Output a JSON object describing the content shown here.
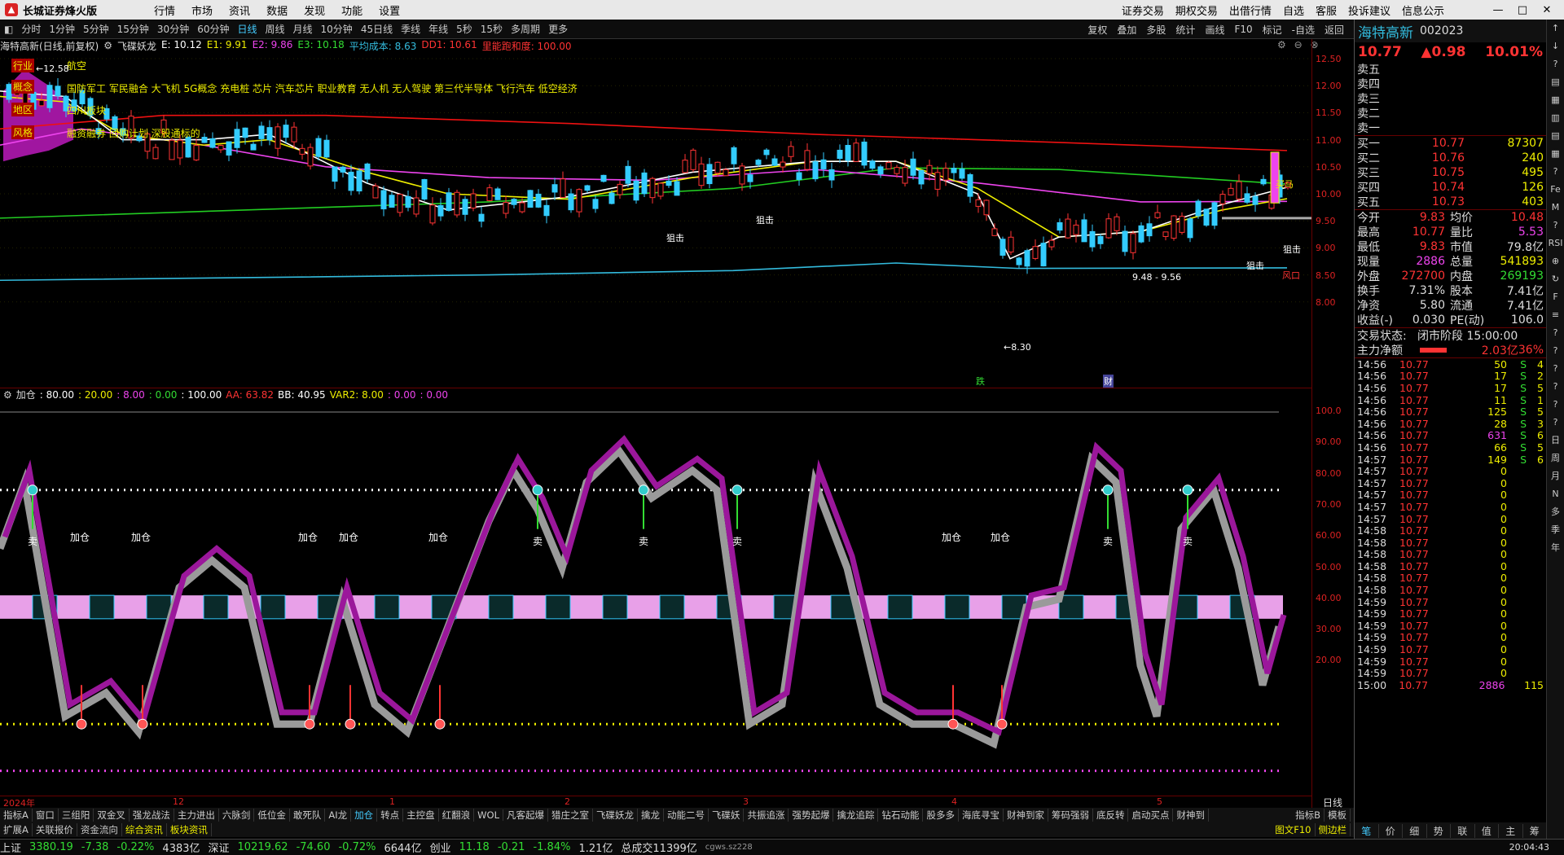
{
  "app": {
    "name": "长城证券烽火版",
    "menu": [
      "行情",
      "市场",
      "资讯",
      "数据",
      "发现",
      "功能",
      "设置"
    ],
    "right_menu": [
      "证券交易",
      "期权交易",
      "出借行情",
      "自选",
      "客服",
      "投诉建议",
      "信息公示"
    ]
  },
  "toolbar": {
    "items": [
      "分时",
      "1分钟",
      "5分钟",
      "15分钟",
      "30分钟",
      "60分钟",
      "日线",
      "周线",
      "月线",
      "10分钟",
      "45日线",
      "季线",
      "年线",
      "5秒",
      "15秒",
      "多周期",
      "更多"
    ],
    "active": "日线",
    "right": [
      "复权",
      "叠加",
      "多股",
      "统计",
      "画线",
      "F10",
      "标记",
      "-自选",
      "返回"
    ]
  },
  "main_chart": {
    "stock_title": "海特高新(日线,前复权)",
    "indicator_name": "飞碟妖龙",
    "legend": [
      {
        "t": "E: 10.12",
        "c": "#fff"
      },
      {
        "t": "E1: 9.91",
        "c": "#ee0"
      },
      {
        "t": "E2: 9.86",
        "c": "#e4e"
      },
      {
        "t": "E3: 10.18",
        "c": "#3d3"
      },
      {
        "t": "平均成本: 8.63",
        "c": "#3bd"
      },
      {
        "t": "DD1: 10.61",
        "c": "#f33"
      },
      {
        "t": "里能跑和度: 100.00",
        "c": "#f33"
      }
    ],
    "concept_labels": {
      "tag1": "行业",
      "tag2": "概念",
      "tag3": "地区",
      "tag4": "风格",
      "l1": "航空",
      "l2": "国防军工 军民融合 大飞机 5G概念 充电桩 芯片 汽车芯片 职业教育 无人机 无人驾驶 第三代半导体 飞行汽车 低空经济",
      "l3": "四川板块",
      "l4": "融资融券 回购计划 深股通标的"
    },
    "annotations": {
      "high": "12.58",
      "low": "8.30",
      "range": "9.48 - 9.56",
      "jiji": "狙击",
      "buyhorse": "买马",
      "fengkou": "风口",
      "die": "跌",
      "cai": "财"
    }
  },
  "yaxis_main": [
    "12.50",
    "12.00",
    "11.50",
    "11.00",
    "10.50",
    "10.00",
    "9.50",
    "9.00",
    "8.50",
    "8.00"
  ],
  "yaxis_sub": [
    "100.0",
    "90.00",
    "80.00",
    "70.00",
    "60.00",
    "50.00",
    "40.00",
    "30.00",
    "20.00"
  ],
  "sub_chart": {
    "name": "加仓",
    "params": [
      {
        "t": ": 80.00",
        "c": "#fff"
      },
      {
        "t": ": 20.00",
        "c": "#ee0"
      },
      {
        "t": ": 8.00",
        "c": "#e4e"
      },
      {
        "t": ": 0.00",
        "c": "#3d3"
      },
      {
        "t": ": 100.00",
        "c": "#fff"
      },
      {
        "t": "AA: 63.82",
        "c": "#f33"
      },
      {
        "t": "BB: 40.95",
        "c": "#fff"
      },
      {
        "t": "VAR2: 8.00",
        "c": "#ee0"
      },
      {
        "t": ": 0.00",
        "c": "#e4e"
      },
      {
        "t": ": 0.00",
        "c": "#e4e"
      }
    ],
    "add_label": "加仓",
    "sell_label": "卖"
  },
  "xaxis": {
    "labels": [
      "2024年",
      "12",
      "1",
      "2",
      "3",
      "4",
      "5"
    ],
    "period": "日线"
  },
  "bottom_tabs": [
    "指标A",
    "窗口",
    "三组阳",
    "双金叉",
    "强龙战法",
    "主力进出",
    "六脉剑",
    "低位金",
    "敢死队",
    "AI龙",
    "加仓",
    "转点",
    "主控盘",
    "红翻浪",
    "WOL",
    "凡客起爆",
    "猎庄之室",
    "飞碟妖龙",
    "擒龙",
    "动能二号",
    "飞碟妖",
    "共振追涨",
    "强势起爆",
    "擒龙追踪",
    "钻石动能",
    "股多多",
    "海底寻宝",
    "财神到家",
    "筹码强弱",
    "底反转",
    "启动买点",
    "财神到"
  ],
  "bottom_tabs_active": "加仓",
  "bottom_tabs_right": [
    "指标B",
    "模板"
  ],
  "bottom_tabs2": [
    "扩展A",
    "关联报价",
    "资金流向",
    "综合资讯",
    "板块资讯"
  ],
  "bottom_tabs2_right": [
    "图文F10",
    "侧边栏"
  ],
  "status": {
    "sh": "上证",
    "sh_v": "3380.19",
    "sh_c": "-7.38",
    "sh_p": "-0.22%",
    "sh_a": "4383亿",
    "sz": "深证",
    "sz_v": "10219.62",
    "sz_c": "-74.60",
    "sz_p": "-0.72%",
    "sz_a": "6644亿",
    "cy": "创业",
    "cy_v": "11.18",
    "cy_c": "-0.21",
    "cy_p": "-1.84%",
    "cy_a": "1.21亿",
    "total": "总成交11399亿",
    "extra": "cgws.sz228",
    "time": "20:04:43"
  },
  "quote": {
    "name": "海特高新",
    "code": "002023",
    "price": "10.77",
    "change": "▲0.98",
    "pct": "10.01%",
    "asks": [
      {
        "l": "卖五",
        "p": "",
        "v": ""
      },
      {
        "l": "卖四",
        "p": "",
        "v": ""
      },
      {
        "l": "卖三",
        "p": "",
        "v": ""
      },
      {
        "l": "卖二",
        "p": "",
        "v": ""
      },
      {
        "l": "卖一",
        "p": "",
        "v": ""
      }
    ],
    "bids": [
      {
        "l": "买一",
        "p": "10.77",
        "v": "87307"
      },
      {
        "l": "买二",
        "p": "10.76",
        "v": "240"
      },
      {
        "l": "买三",
        "p": "10.75",
        "v": "495"
      },
      {
        "l": "买四",
        "p": "10.74",
        "v": "126"
      },
      {
        "l": "买五",
        "p": "10.73",
        "v": "403"
      }
    ],
    "stats": [
      {
        "a": "今开",
        "av": "9.83",
        "ac": "red",
        "b": "均价",
        "bv": "10.48",
        "bc": "red"
      },
      {
        "a": "最高",
        "av": "10.77",
        "ac": "red",
        "b": "量比",
        "bv": "5.53",
        "bc": "mag"
      },
      {
        "a": "最低",
        "av": "9.83",
        "ac": "red",
        "b": "市值",
        "bv": "79.8亿",
        "bc": "wht"
      },
      {
        "a": "现量",
        "av": "2886",
        "ac": "mag",
        "b": "总量",
        "bv": "541893",
        "bc": "yel"
      },
      {
        "a": "外盘",
        "av": "272700",
        "ac": "red",
        "b": "内盘",
        "bv": "269193",
        "bc": "grn"
      },
      {
        "a": "换手",
        "av": "7.31%",
        "ac": "wht",
        "b": "股本",
        "bv": "7.41亿",
        "bc": "wht"
      },
      {
        "a": "净资",
        "av": "5.80",
        "ac": "wht",
        "b": "流通",
        "bv": "7.41亿",
        "bc": "wht"
      },
      {
        "a": "收益(-)",
        "av": "0.030",
        "ac": "wht",
        "b": "PE(动)",
        "bv": "106.0",
        "bc": "wht"
      }
    ],
    "trade_state_label": "交易状态:",
    "trade_state": "闭市阶段 15:00:00",
    "net_flow_label": "主力净额",
    "net_flow": "2.03亿",
    "net_flow_pct": "36%",
    "ticks": [
      [
        "14:56",
        "10.77",
        "50",
        "S",
        "4"
      ],
      [
        "14:56",
        "10.77",
        "17",
        "S",
        "2"
      ],
      [
        "14:56",
        "10.77",
        "17",
        "S",
        "5"
      ],
      [
        "14:56",
        "10.77",
        "11",
        "S",
        "1"
      ],
      [
        "14:56",
        "10.77",
        "125",
        "S",
        "5"
      ],
      [
        "14:56",
        "10.77",
        "28",
        "S",
        "3"
      ],
      [
        "14:56",
        "10.77",
        "631",
        "S",
        "6"
      ],
      [
        "14:56",
        "10.77",
        "66",
        "S",
        "5"
      ],
      [
        "14:57",
        "10.77",
        "149",
        "S",
        "6"
      ],
      [
        "14:57",
        "10.77",
        "0",
        "",
        ""
      ],
      [
        "14:57",
        "10.77",
        "0",
        "",
        ""
      ],
      [
        "14:57",
        "10.77",
        "0",
        "",
        ""
      ],
      [
        "14:57",
        "10.77",
        "0",
        "",
        ""
      ],
      [
        "14:57",
        "10.77",
        "0",
        "",
        ""
      ],
      [
        "14:58",
        "10.77",
        "0",
        "",
        ""
      ],
      [
        "14:58",
        "10.77",
        "0",
        "",
        ""
      ],
      [
        "14:58",
        "10.77",
        "0",
        "",
        ""
      ],
      [
        "14:58",
        "10.77",
        "0",
        "",
        ""
      ],
      [
        "14:58",
        "10.77",
        "0",
        "",
        ""
      ],
      [
        "14:58",
        "10.77",
        "0",
        "",
        ""
      ],
      [
        "14:59",
        "10.77",
        "0",
        "",
        ""
      ],
      [
        "14:59",
        "10.77",
        "0",
        "",
        ""
      ],
      [
        "14:59",
        "10.77",
        "0",
        "",
        ""
      ],
      [
        "14:59",
        "10.77",
        "0",
        "",
        ""
      ],
      [
        "14:59",
        "10.77",
        "0",
        "",
        ""
      ],
      [
        "14:59",
        "10.77",
        "0",
        "",
        ""
      ],
      [
        "14:59",
        "10.77",
        "0",
        "",
        ""
      ],
      [
        "15:00",
        "10.77",
        "2886",
        "",
        "115"
      ]
    ],
    "foot": [
      "笔",
      "价",
      "细",
      "势",
      "联",
      "值",
      "主",
      "筹"
    ]
  },
  "sidebar": [
    "↑",
    "↓",
    "?",
    "▤",
    "▦",
    "▥",
    "▤",
    "▦",
    "?",
    "Fe",
    "M",
    "?",
    "RSI",
    "⊕",
    "↻",
    "F",
    "≡",
    "?",
    "?",
    "?",
    "?",
    "?",
    "?",
    "日",
    "周",
    "月",
    "N",
    "多",
    "季",
    "年"
  ]
}
